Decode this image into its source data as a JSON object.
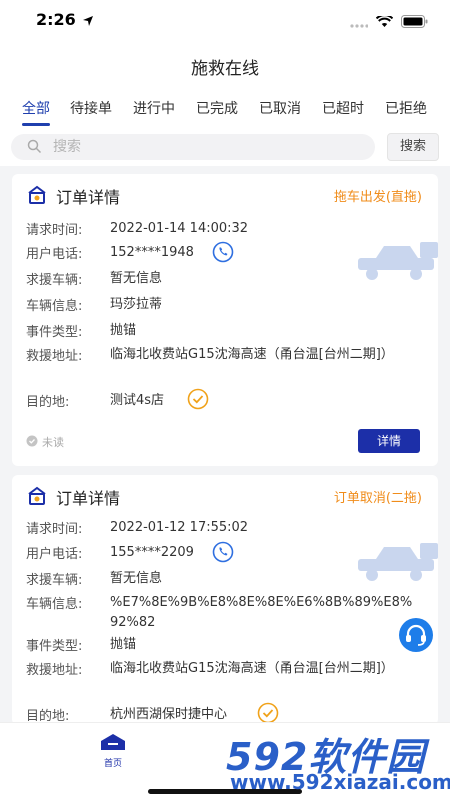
{
  "status_bar": {
    "time": "2:26"
  },
  "nav": {
    "title": "施救在线"
  },
  "tabs": [
    "全部",
    "待接单",
    "进行中",
    "已完成",
    "已取消",
    "已超时",
    "已拒绝"
  ],
  "search": {
    "placeholder": "搜索",
    "button": "搜索"
  },
  "orders": [
    {
      "title": "订单详情",
      "status": "拖车出发(直拖)",
      "fields": [
        {
          "label": "请求时间:",
          "value": "2022-01-14 14:00:32"
        },
        {
          "label": "用户电话:",
          "value": "152****1948"
        },
        {
          "label": "求援车辆:",
          "value": "暂无信息"
        },
        {
          "label": "车辆信息:",
          "value": "玛莎拉蒂"
        },
        {
          "label": "事件类型:",
          "value": "抛锚"
        },
        {
          "label": "救援地址:",
          "value": "临海北收费站G15沈海高速（甬台温[台州二期]）"
        },
        {
          "label": "目的地:",
          "value": "测试4s店"
        }
      ],
      "read_state": "未读",
      "detail_button": "详情"
    },
    {
      "title": "订单详情",
      "status": "订单取消(二拖)",
      "fields": [
        {
          "label": "请求时间:",
          "value": "2022-01-12 17:55:02"
        },
        {
          "label": "用户电话:",
          "value": "155****2209"
        },
        {
          "label": "求援车辆:",
          "value": "暂无信息"
        },
        {
          "label": "车辆信息:",
          "value": "%E7%8E%9B%E8%8E%8E%E6%8B%89%E8%92%82"
        },
        {
          "label": "事件类型:",
          "value": "抛锚"
        },
        {
          "label": "救援地址:",
          "value": "临海北收费站G15沈海高速（甬台温[台州二期]）"
        },
        {
          "label": "目的地:",
          "value": "杭州西湖保时捷中心"
        }
      ]
    }
  ],
  "bottom_nav": {
    "home_label": "首页"
  },
  "watermark": {
    "big": "592软件园",
    "small": "www.592xiazai.com"
  },
  "colors": {
    "accent": "#1c2fa8",
    "status_orange": "#f08c1a",
    "phone_blue": "#2f6fe0",
    "check_orange": "#f0a21a"
  }
}
